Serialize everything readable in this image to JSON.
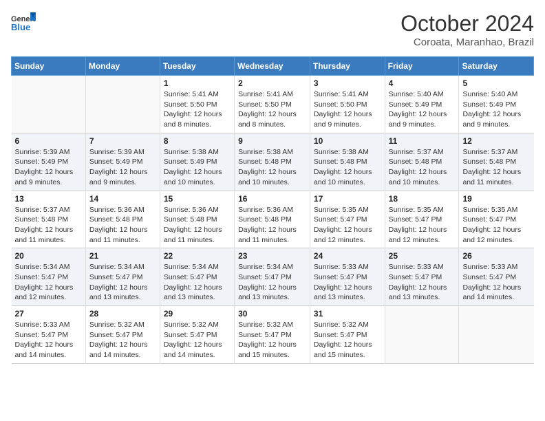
{
  "logo": {
    "line1": "General",
    "line2": "Blue"
  },
  "title": "October 2024",
  "subtitle": "Coroata, Maranhao, Brazil",
  "headers": [
    "Sunday",
    "Monday",
    "Tuesday",
    "Wednesday",
    "Thursday",
    "Friday",
    "Saturday"
  ],
  "weeks": [
    [
      {
        "day": "",
        "info": ""
      },
      {
        "day": "",
        "info": ""
      },
      {
        "day": "1",
        "info": "Sunrise: 5:41 AM\nSunset: 5:50 PM\nDaylight: 12 hours and 8 minutes."
      },
      {
        "day": "2",
        "info": "Sunrise: 5:41 AM\nSunset: 5:50 PM\nDaylight: 12 hours and 8 minutes."
      },
      {
        "day": "3",
        "info": "Sunrise: 5:41 AM\nSunset: 5:50 PM\nDaylight: 12 hours and 9 minutes."
      },
      {
        "day": "4",
        "info": "Sunrise: 5:40 AM\nSunset: 5:49 PM\nDaylight: 12 hours and 9 minutes."
      },
      {
        "day": "5",
        "info": "Sunrise: 5:40 AM\nSunset: 5:49 PM\nDaylight: 12 hours and 9 minutes."
      }
    ],
    [
      {
        "day": "6",
        "info": "Sunrise: 5:39 AM\nSunset: 5:49 PM\nDaylight: 12 hours and 9 minutes."
      },
      {
        "day": "7",
        "info": "Sunrise: 5:39 AM\nSunset: 5:49 PM\nDaylight: 12 hours and 9 minutes."
      },
      {
        "day": "8",
        "info": "Sunrise: 5:38 AM\nSunset: 5:49 PM\nDaylight: 12 hours and 10 minutes."
      },
      {
        "day": "9",
        "info": "Sunrise: 5:38 AM\nSunset: 5:48 PM\nDaylight: 12 hours and 10 minutes."
      },
      {
        "day": "10",
        "info": "Sunrise: 5:38 AM\nSunset: 5:48 PM\nDaylight: 12 hours and 10 minutes."
      },
      {
        "day": "11",
        "info": "Sunrise: 5:37 AM\nSunset: 5:48 PM\nDaylight: 12 hours and 10 minutes."
      },
      {
        "day": "12",
        "info": "Sunrise: 5:37 AM\nSunset: 5:48 PM\nDaylight: 12 hours and 11 minutes."
      }
    ],
    [
      {
        "day": "13",
        "info": "Sunrise: 5:37 AM\nSunset: 5:48 PM\nDaylight: 12 hours and 11 minutes."
      },
      {
        "day": "14",
        "info": "Sunrise: 5:36 AM\nSunset: 5:48 PM\nDaylight: 12 hours and 11 minutes."
      },
      {
        "day": "15",
        "info": "Sunrise: 5:36 AM\nSunset: 5:48 PM\nDaylight: 12 hours and 11 minutes."
      },
      {
        "day": "16",
        "info": "Sunrise: 5:36 AM\nSunset: 5:48 PM\nDaylight: 12 hours and 11 minutes."
      },
      {
        "day": "17",
        "info": "Sunrise: 5:35 AM\nSunset: 5:47 PM\nDaylight: 12 hours and 12 minutes."
      },
      {
        "day": "18",
        "info": "Sunrise: 5:35 AM\nSunset: 5:47 PM\nDaylight: 12 hours and 12 minutes."
      },
      {
        "day": "19",
        "info": "Sunrise: 5:35 AM\nSunset: 5:47 PM\nDaylight: 12 hours and 12 minutes."
      }
    ],
    [
      {
        "day": "20",
        "info": "Sunrise: 5:34 AM\nSunset: 5:47 PM\nDaylight: 12 hours and 12 minutes."
      },
      {
        "day": "21",
        "info": "Sunrise: 5:34 AM\nSunset: 5:47 PM\nDaylight: 12 hours and 13 minutes."
      },
      {
        "day": "22",
        "info": "Sunrise: 5:34 AM\nSunset: 5:47 PM\nDaylight: 12 hours and 13 minutes."
      },
      {
        "day": "23",
        "info": "Sunrise: 5:34 AM\nSunset: 5:47 PM\nDaylight: 12 hours and 13 minutes."
      },
      {
        "day": "24",
        "info": "Sunrise: 5:33 AM\nSunset: 5:47 PM\nDaylight: 12 hours and 13 minutes."
      },
      {
        "day": "25",
        "info": "Sunrise: 5:33 AM\nSunset: 5:47 PM\nDaylight: 12 hours and 13 minutes."
      },
      {
        "day": "26",
        "info": "Sunrise: 5:33 AM\nSunset: 5:47 PM\nDaylight: 12 hours and 14 minutes."
      }
    ],
    [
      {
        "day": "27",
        "info": "Sunrise: 5:33 AM\nSunset: 5:47 PM\nDaylight: 12 hours and 14 minutes."
      },
      {
        "day": "28",
        "info": "Sunrise: 5:32 AM\nSunset: 5:47 PM\nDaylight: 12 hours and 14 minutes."
      },
      {
        "day": "29",
        "info": "Sunrise: 5:32 AM\nSunset: 5:47 PM\nDaylight: 12 hours and 14 minutes."
      },
      {
        "day": "30",
        "info": "Sunrise: 5:32 AM\nSunset: 5:47 PM\nDaylight: 12 hours and 15 minutes."
      },
      {
        "day": "31",
        "info": "Sunrise: 5:32 AM\nSunset: 5:47 PM\nDaylight: 12 hours and 15 minutes."
      },
      {
        "day": "",
        "info": ""
      },
      {
        "day": "",
        "info": ""
      }
    ]
  ]
}
